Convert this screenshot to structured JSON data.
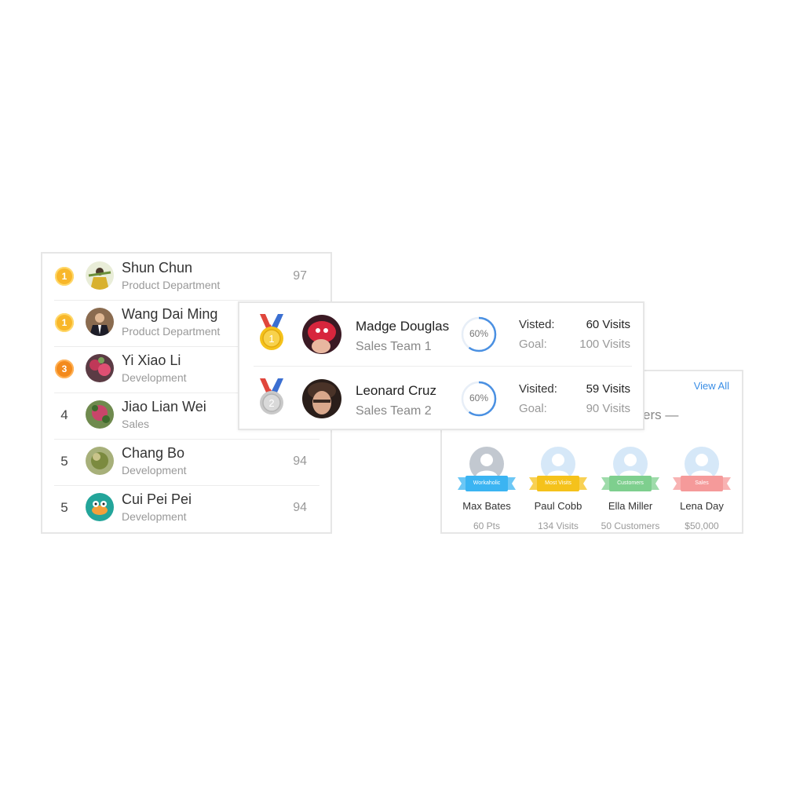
{
  "leaderboard": {
    "rows": [
      {
        "rank": "1",
        "rank_style": "gold",
        "name": "Shun Chun",
        "dept": "Product Department",
        "score": "97"
      },
      {
        "rank": "1",
        "rank_style": "gold",
        "name": "Wang Dai Ming",
        "dept": "Product Department",
        "score": ""
      },
      {
        "rank": "3",
        "rank_style": "orange",
        "name": "Yi Xiao Li",
        "dept": "Development",
        "score": ""
      },
      {
        "rank": "4",
        "rank_style": "plain",
        "name": "Jiao Lian Wei",
        "dept": "Sales",
        "score": ""
      },
      {
        "rank": "5",
        "rank_style": "plain",
        "name": "Chang Bo",
        "dept": "Development",
        "score": "94"
      },
      {
        "rank": "5",
        "rank_style": "plain",
        "name": "Cui Pei Pei",
        "dept": "Development",
        "score": "94"
      }
    ]
  },
  "top_sales": {
    "rows": [
      {
        "medal": "1",
        "medal_color": "#f5c21b",
        "name": "Madge Douglas",
        "team": "Sales Team 1",
        "progress_percent": 60,
        "progress_label": "60%",
        "visited_label": "Visted:",
        "visited_value": "60 Visits",
        "goal_label": "Goal:",
        "goal_value": "100 Visits"
      },
      {
        "medal": "2",
        "medal_color": "#c9c9c9",
        "name": "Leonard Cruz",
        "team": "Sales Team 2",
        "progress_percent": 60,
        "progress_label": "60%",
        "visited_label": "Visited:",
        "visited_value": "59 Visits",
        "goal_label": "Goal:",
        "goal_value": "90 Visits"
      }
    ],
    "ring_color": "#4a90e2"
  },
  "team_stars": {
    "view_all": "View All",
    "title_fragment": "ers —",
    "stars": [
      {
        "badge": "Workaholic",
        "badge_color": "#3bb4f2",
        "name": "Max Bates",
        "stat": "60 Pts",
        "avatar_style": "dark"
      },
      {
        "badge": "Most Visits",
        "badge_color": "#f5c21b",
        "name": "Paul Cobb",
        "stat": "134 Visits",
        "avatar_style": "light"
      },
      {
        "badge": "Customers",
        "badge_color": "#7ecf8e",
        "name": "Ella Miller",
        "stat": "50 Customers",
        "avatar_style": "light"
      },
      {
        "badge": "Sales",
        "badge_color": "#f59a9a",
        "name": "Lena Day",
        "stat": "$50,000",
        "avatar_style": "light"
      }
    ]
  }
}
